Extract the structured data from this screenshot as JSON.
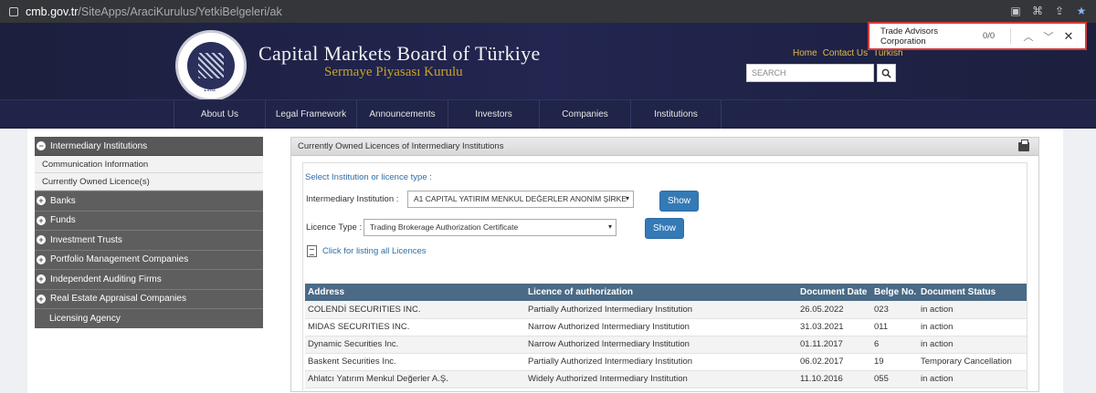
{
  "browser": {
    "url_host": "cmb.gov.tr",
    "url_path": "/SiteApps/AraciKurulus/YetkiBelgeleri/ak"
  },
  "header": {
    "seal_year": "1982",
    "title": "Capital Markets Board of Türkiye",
    "subtitle": "Sermaye Piyasası Kurulu",
    "links": [
      "Home",
      "Contact Us",
      "Turkish"
    ],
    "search_placeholder": "SEARCH"
  },
  "find_bar": {
    "query": "Trade Advisors Corporation",
    "count": "0/0"
  },
  "nav": {
    "items": [
      "About Us",
      "Legal Framework",
      "Announcements",
      "Investors",
      "Companies",
      "Institutions"
    ]
  },
  "sidebar": {
    "active_section": "Intermediary Institutions",
    "sub_items": [
      "Communication Information",
      "Currently Owned Licence(s)"
    ],
    "items": [
      "Banks",
      "Funds",
      "Investment Trusts",
      "Portfolio Management Companies",
      "Independent Auditing Firms",
      "Real Estate Appraisal Companies"
    ],
    "last_item": "Licensing Agency"
  },
  "panel": {
    "title": "Currently Owned Licences of Intermediary Institutions",
    "select_prompt": "Select Institution or licence type :",
    "institution_label": "Intermediary Institution :",
    "institution_value": "A1 CAPITAL YATIRIM MENKUL DEĞERLER ANONİM ŞİRKE",
    "licence_label": "Licence Type :",
    "licence_value": "Trading Brokerage Authorization Certificate",
    "show_label": "Show",
    "list_all_link": "Click for listing all Licences"
  },
  "table": {
    "headers": [
      "Address",
      "Licence of authorization",
      "Document Date",
      "Belge No.",
      "Document Status"
    ],
    "rows": [
      [
        "COLENDİ SECURITIES INC.",
        "Partially Authorized Intermediary Institution",
        "26.05.2022",
        "023",
        "in action"
      ],
      [
        "MIDAS SECURITIES INC.",
        "Narrow Authorized Intermediary Institution",
        "31.03.2021",
        "011",
        "in action"
      ],
      [
        "Dynamic Securities Inc.",
        "Narrow Authorized Intermediary Institution",
        "01.11.2017",
        "6",
        "in action"
      ],
      [
        "Baskent Securities Inc.",
        "Partially Authorized Intermediary Institution",
        "06.02.2017",
        "19",
        "Temporary Cancellation"
      ],
      [
        "Ahlatcı Yatırım Menkul Değerler A.Ş.",
        "Widely Authorized Intermediary Institution",
        "11.10.2016",
        "055",
        "in action"
      ]
    ]
  }
}
